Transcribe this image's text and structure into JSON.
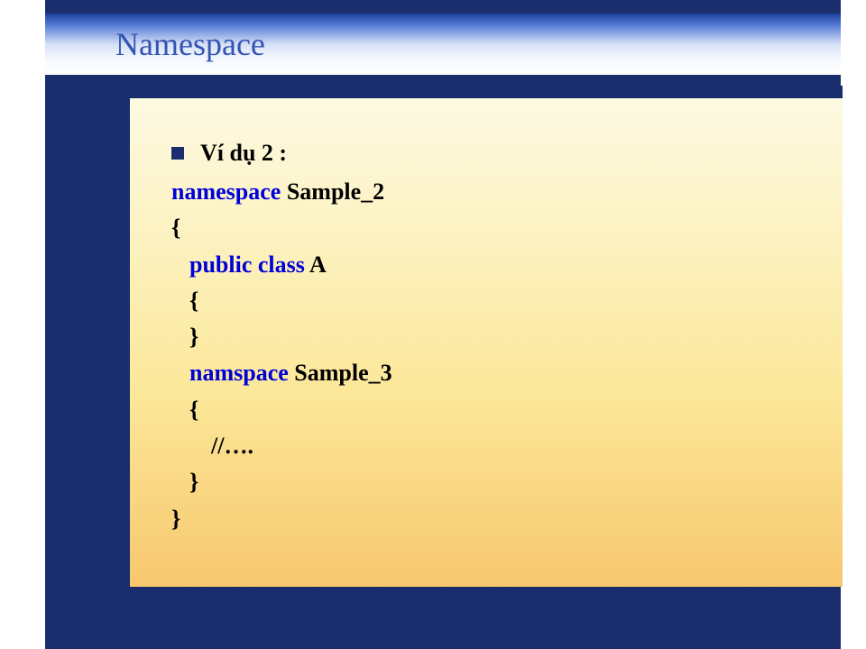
{
  "title": "Namespace",
  "bullet": "Ví dụ 2 :",
  "code": {
    "l1a": "namespace",
    "l1b": "  Sample_2",
    "l2": "{",
    "l3a": "public class ",
    "l3b": "A",
    "l4": "{",
    "l5": "}",
    "l6a": "namspace ",
    "l6b": "Sample_3",
    "l7": "{",
    "l8": "//….",
    "l9": "}",
    "l10": "}"
  }
}
